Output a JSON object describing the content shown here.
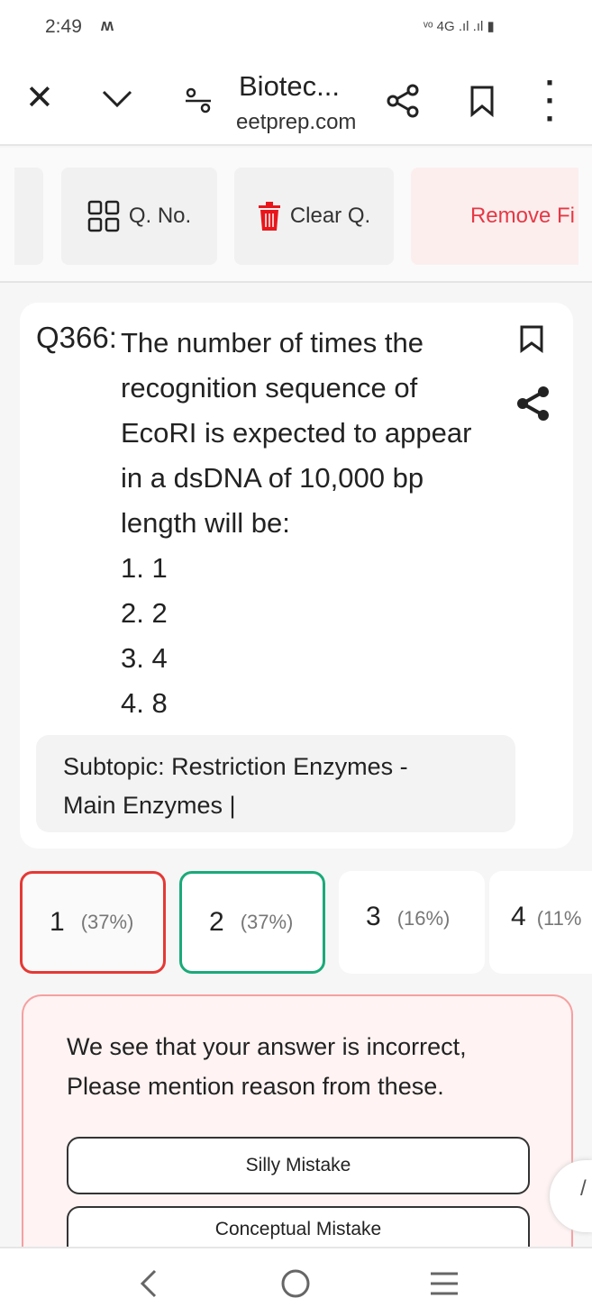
{
  "status": {
    "time": "2:49",
    "carrier_icon": "m-logo",
    "network": "4G"
  },
  "appbar": {
    "title": "Biotec...",
    "url": "eetprep.com"
  },
  "toolbar": {
    "qno": "Q. No.",
    "clear": "Clear Q.",
    "remove": "Remove Fi"
  },
  "question": {
    "number": "Q366:",
    "lines": [
      "The number of times the",
      "recognition sequence of",
      "EcoRI is expected to appear",
      "in a dsDNA of 10,000 bp",
      "length will be:"
    ],
    "options": [
      "1. 1",
      "2. 2",
      "3. 4",
      "4. 8"
    ],
    "subtopic_line1": "Subtopic:  Restriction Enzymes -",
    "subtopic_line2": "Main Enzymes |"
  },
  "answers": [
    {
      "n": "1",
      "pct": "(37%)",
      "state": "incorrect"
    },
    {
      "n": "2",
      "pct": "(37%)",
      "state": "correct"
    },
    {
      "n": "3",
      "pct": "(16%)"
    },
    {
      "n": "4",
      "pct": "(11%"
    }
  ],
  "feedback": {
    "line1": "We see that your answer is incorrect,",
    "line2": "Please mention reason from these.",
    "reasons": [
      "Silly Mistake",
      "Conceptual Mistake"
    ]
  },
  "colors": {
    "incorrect": "#e53935",
    "correct": "#1aaa7a",
    "danger": "#e53945"
  }
}
